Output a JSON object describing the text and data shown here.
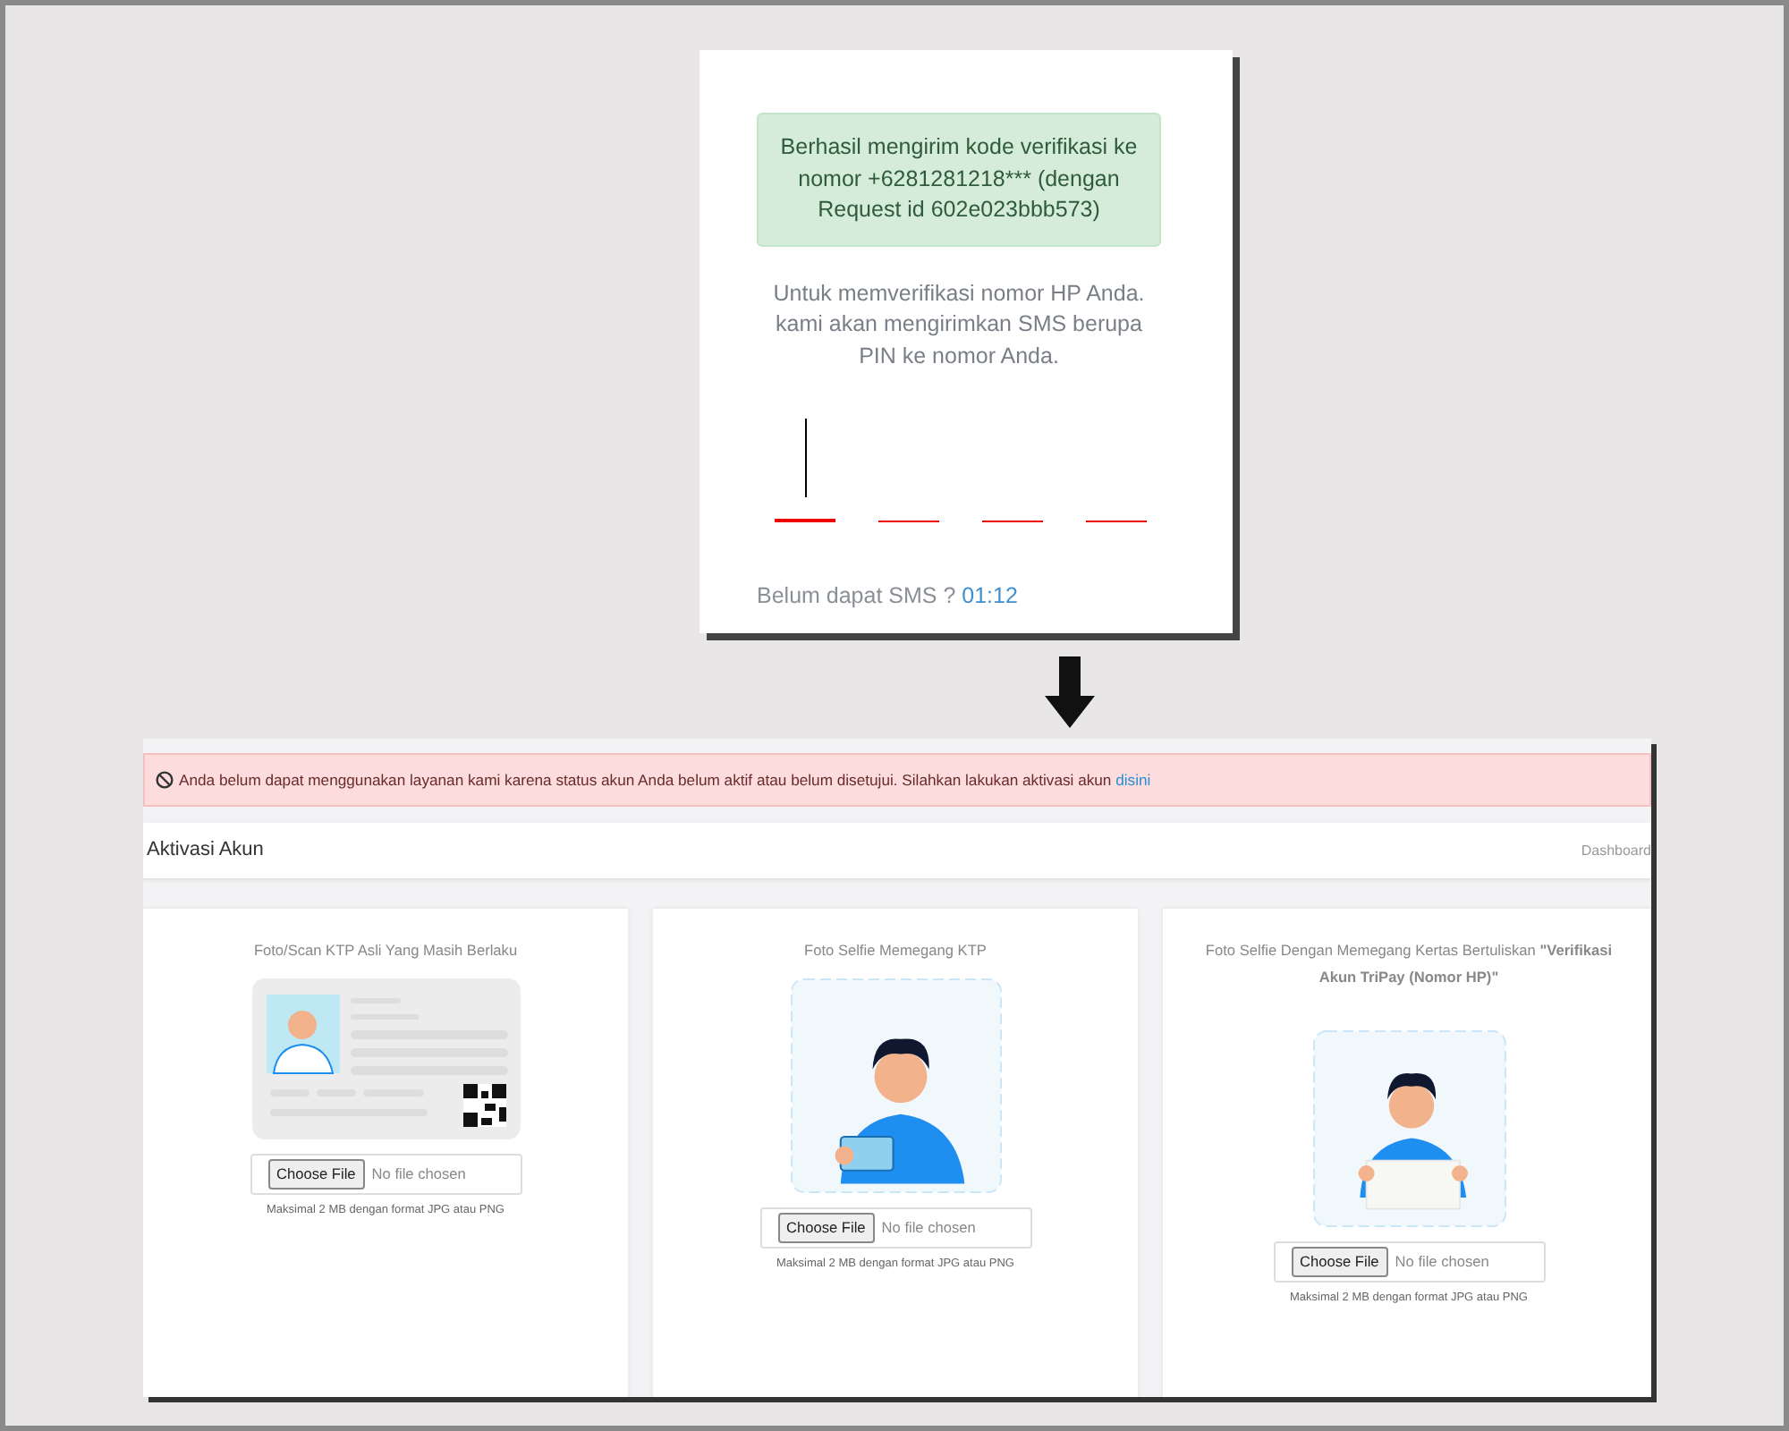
{
  "verification_card": {
    "alert": "Berhasil mengirim kode verifikasi ke nomor +6281281218*** (dengan Request id 602e023bbb573)",
    "instructions": "Untuk memverifikasi nomor HP Anda. kami akan mengirimkan SMS berupa PIN ke nomor Anda.",
    "pin_slots": [
      {
        "focused": true
      },
      {
        "focused": false
      },
      {
        "focused": false
      },
      {
        "focused": false
      }
    ],
    "resend_label": "Belum dapat SMS ?",
    "countdown": "01:12"
  },
  "activation_page": {
    "alert": {
      "message": "Anda belum dapat menggunakan layanan kami karena status akun Anda belum aktif atau belum disetujui. Silahkan lakukan aktivasi akun",
      "link": "disini"
    },
    "header": {
      "title": "Aktivasi Akun",
      "breadcrumb": "Dashboard"
    },
    "upload_cards": [
      {
        "kind": "ktp",
        "title": "Foto/Scan KTP Asli Yang Masih Berlaku",
        "button": "Choose File",
        "file_status": "No file chosen",
        "hint": "Maksimal 2 MB dengan format JPG atau PNG"
      },
      {
        "kind": "selfie_card",
        "title": "Foto Selfie Memegang KTP",
        "button": "Choose File",
        "file_status": "No file chosen",
        "hint": "Maksimal 2 MB dengan format JPG atau PNG"
      },
      {
        "kind": "selfie_paper",
        "title": "Foto Selfie Dengan Memegang Kertas Bertuliskan **\"Verifikasi Akun TriPay (Nomor HP)\"**",
        "button": "Choose File",
        "file_status": "No file chosen",
        "hint": "Maksimal 2 MB dengan format JPG atau PNG"
      }
    ]
  }
}
